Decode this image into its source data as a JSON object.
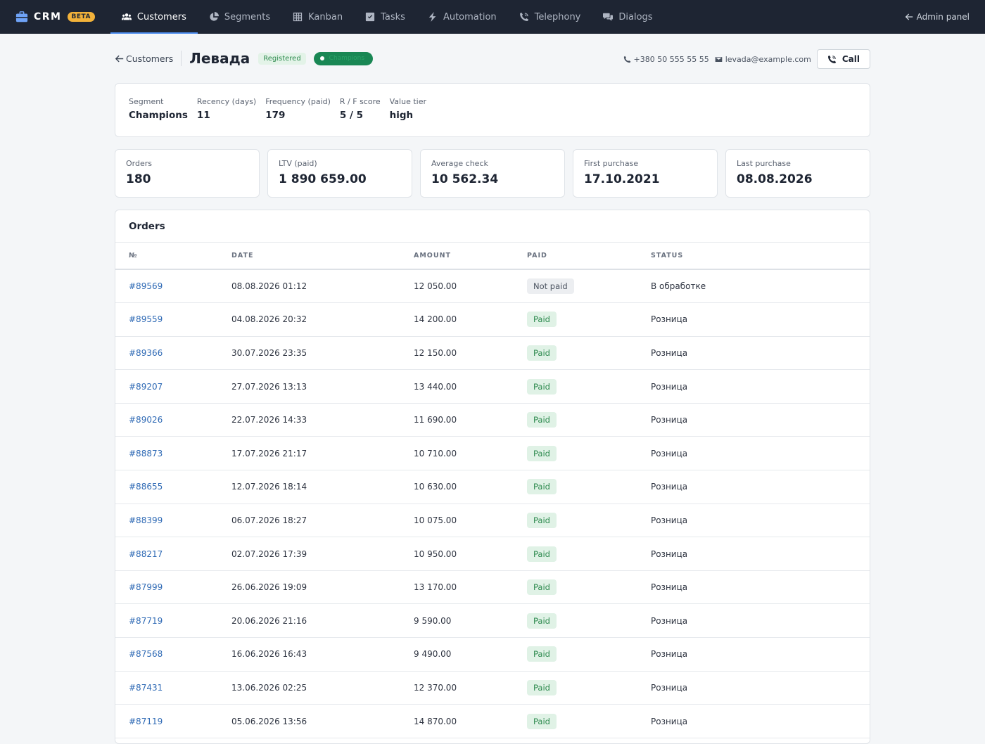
{
  "brand": {
    "name": "CRM",
    "badge": "BETA"
  },
  "nav": [
    {
      "label": "Customers",
      "icon": "users-icon",
      "active": true
    },
    {
      "label": "Segments",
      "icon": "pie-chart-icon",
      "active": false
    },
    {
      "label": "Kanban",
      "icon": "grid-icon",
      "active": false
    },
    {
      "label": "Tasks",
      "icon": "checkbox-icon",
      "active": false
    },
    {
      "label": "Automation",
      "icon": "bolt-icon",
      "active": false
    },
    {
      "label": "Telephony",
      "icon": "phone-volume-icon",
      "active": false
    },
    {
      "label": "Dialogs",
      "icon": "chat-icon",
      "active": false
    }
  ],
  "admin_panel": "Admin panel",
  "header": {
    "back_label": "Customers",
    "customer_name": "Левада",
    "status_badge": "Registered",
    "segment_badge": "Champions",
    "phone": "+380 50 555 55 55",
    "email": "levada@example.com",
    "call_label": "Call"
  },
  "rfm": [
    {
      "label": "Segment",
      "value": "Champions"
    },
    {
      "label": "Recency (days)",
      "value": "11"
    },
    {
      "label": "Frequency (paid)",
      "value": "179"
    },
    {
      "label": "R / F score",
      "value": "5 / 5"
    },
    {
      "label": "Value tier",
      "value": "high"
    }
  ],
  "stats": [
    {
      "label": "Orders",
      "value": "180"
    },
    {
      "label": "LTV (paid)",
      "value": "1 890 659.00"
    },
    {
      "label": "Average check",
      "value": "10 562.34"
    },
    {
      "label": "First purchase",
      "value": "17.10.2021"
    },
    {
      "label": "Last purchase",
      "value": "08.08.2026"
    }
  ],
  "orders": {
    "title": "Orders",
    "columns": [
      "№",
      "DATE",
      "AMOUNT",
      "PAID",
      "STATUS"
    ],
    "rows": [
      {
        "id": "#89569",
        "date": "08.08.2026 01:12",
        "amount": "12 050.00",
        "paid": "Not paid",
        "paid_state": "notpaid",
        "status": "В обработке"
      },
      {
        "id": "#89559",
        "date": "04.08.2026 20:32",
        "amount": "14 200.00",
        "paid": "Paid",
        "paid_state": "paid",
        "status": "Розница"
      },
      {
        "id": "#89366",
        "date": "30.07.2026 23:35",
        "amount": "12 150.00",
        "paid": "Paid",
        "paid_state": "paid",
        "status": "Розница"
      },
      {
        "id": "#89207",
        "date": "27.07.2026 13:13",
        "amount": "13 440.00",
        "paid": "Paid",
        "paid_state": "paid",
        "status": "Розница"
      },
      {
        "id": "#89026",
        "date": "22.07.2026 14:33",
        "amount": "11 690.00",
        "paid": "Paid",
        "paid_state": "paid",
        "status": "Розница"
      },
      {
        "id": "#88873",
        "date": "17.07.2026 21:17",
        "amount": "10 710.00",
        "paid": "Paid",
        "paid_state": "paid",
        "status": "Розница"
      },
      {
        "id": "#88655",
        "date": "12.07.2026 18:14",
        "amount": "10 630.00",
        "paid": "Paid",
        "paid_state": "paid",
        "status": "Розница"
      },
      {
        "id": "#88399",
        "date": "06.07.2026 18:27",
        "amount": "10 075.00",
        "paid": "Paid",
        "paid_state": "paid",
        "status": "Розница"
      },
      {
        "id": "#88217",
        "date": "02.07.2026 17:39",
        "amount": "10 950.00",
        "paid": "Paid",
        "paid_state": "paid",
        "status": "Розница"
      },
      {
        "id": "#87999",
        "date": "26.06.2026 19:09",
        "amount": "13 170.00",
        "paid": "Paid",
        "paid_state": "paid",
        "status": "Розница"
      },
      {
        "id": "#87719",
        "date": "20.06.2026 21:16",
        "amount": "9 590.00",
        "paid": "Paid",
        "paid_state": "paid",
        "status": "Розница"
      },
      {
        "id": "#87568",
        "date": "16.06.2026 16:43",
        "amount": "9 490.00",
        "paid": "Paid",
        "paid_state": "paid",
        "status": "Розница"
      },
      {
        "id": "#87431",
        "date": "13.06.2026 02:25",
        "amount": "12 370.00",
        "paid": "Paid",
        "paid_state": "paid",
        "status": "Розница"
      },
      {
        "id": "#87119",
        "date": "05.06.2026 13:56",
        "amount": "14 870.00",
        "paid": "Paid",
        "paid_state": "paid",
        "status": "Розница"
      }
    ]
  },
  "colors": {
    "navbar_bg": "#1e2533",
    "accent": "#4d8df0",
    "beta_badge": "#f2b23a",
    "paid_bg": "#e0f2e6",
    "paid_text": "#2d8a4e",
    "segment_badge": "#198754",
    "link": "#2f6ab5"
  }
}
